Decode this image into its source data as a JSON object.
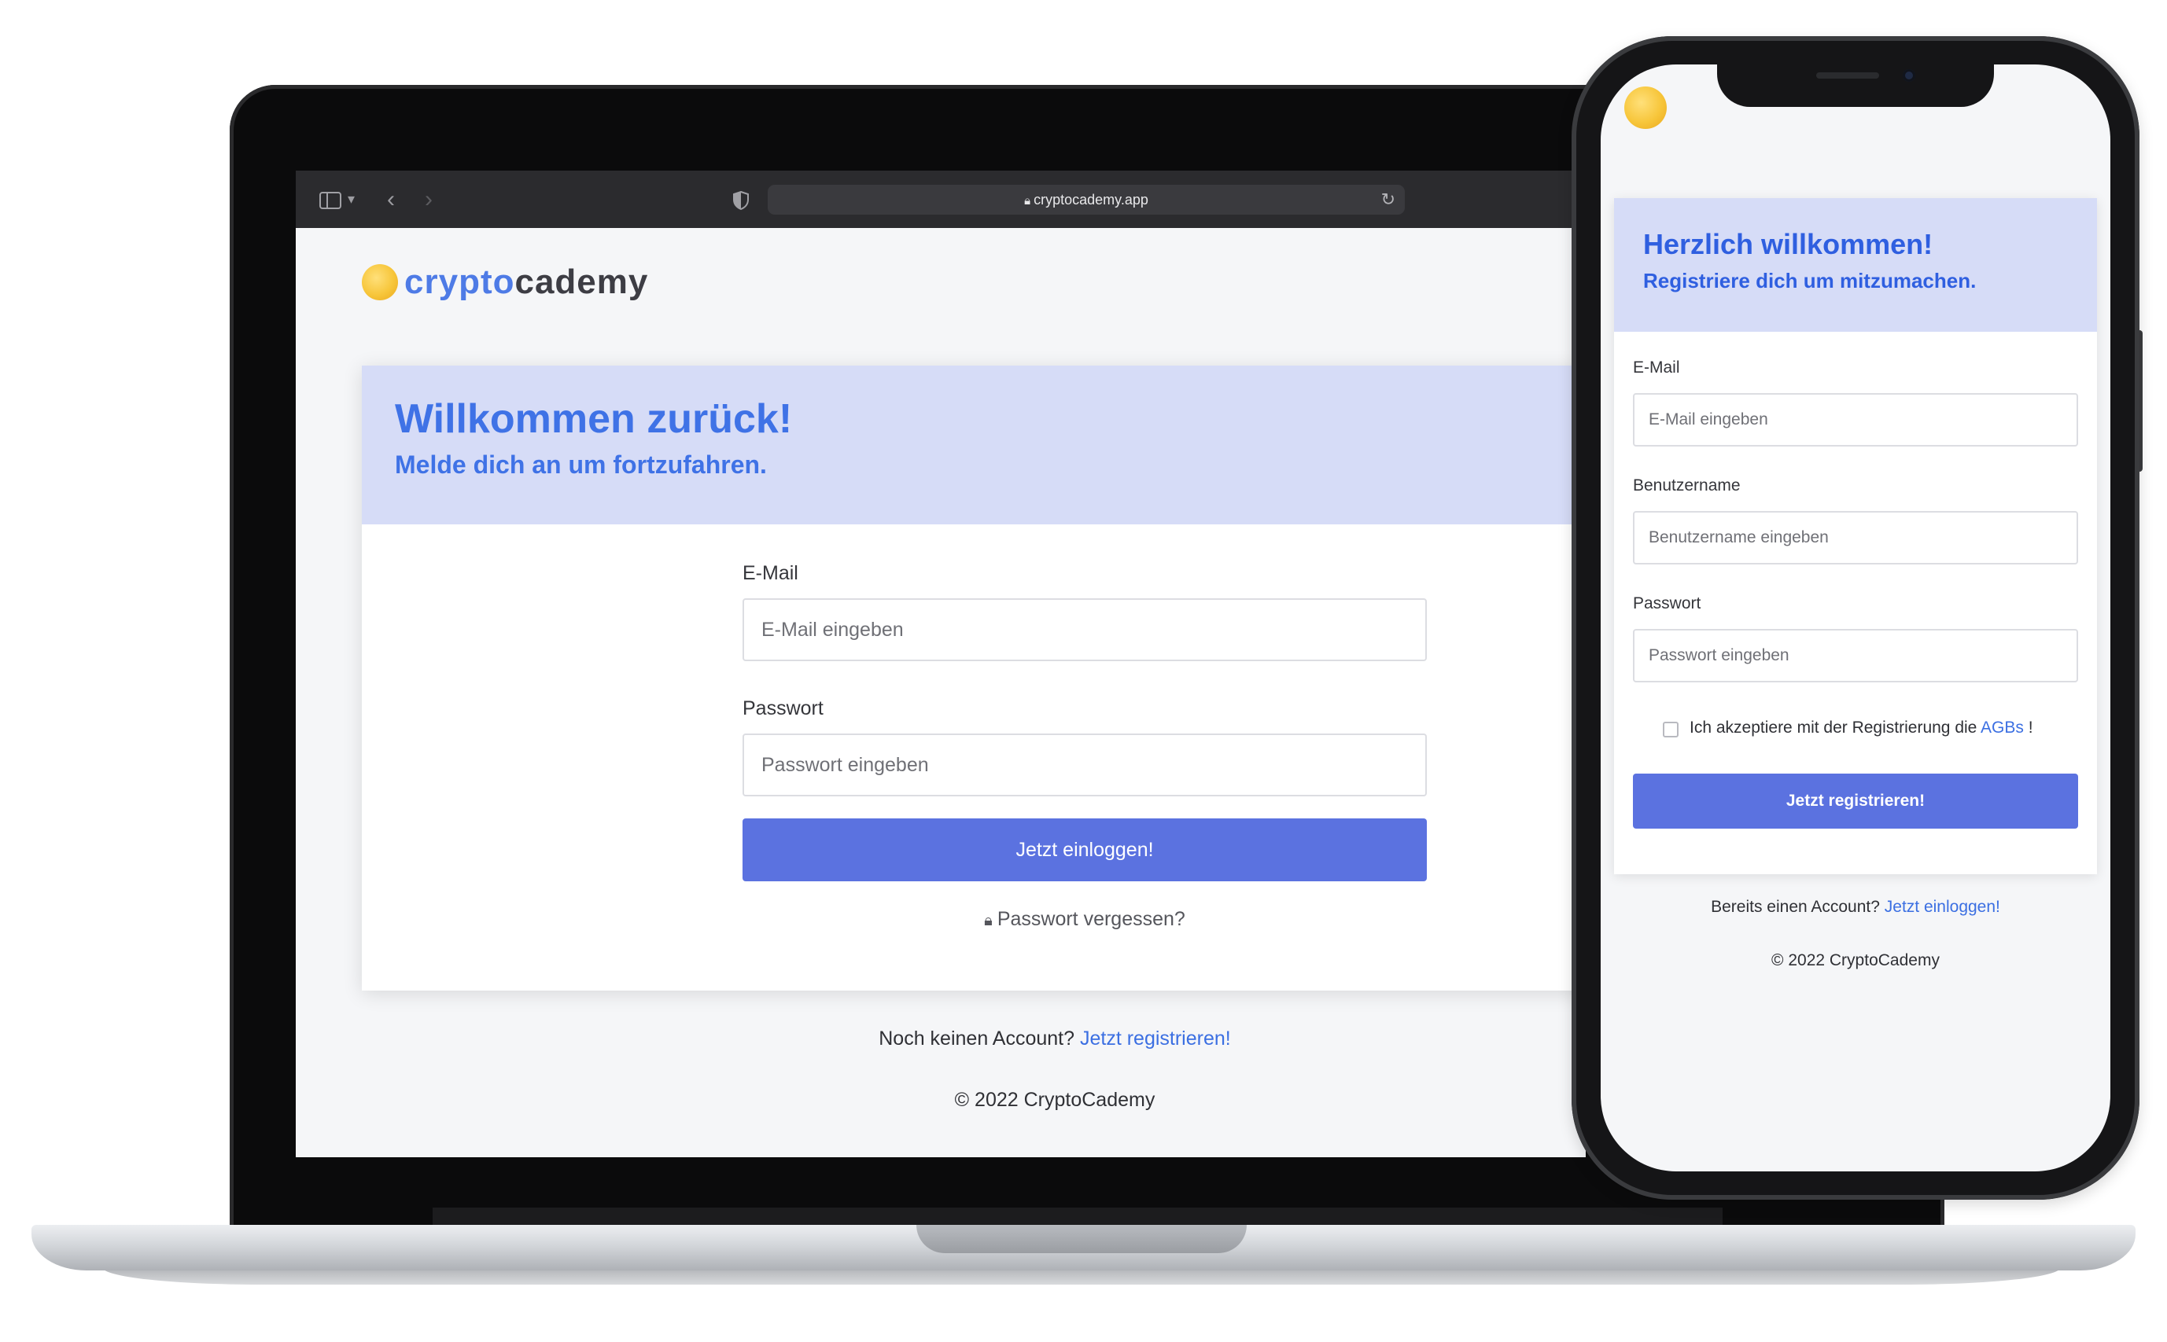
{
  "browser": {
    "url": "cryptocademy.app",
    "icons": {
      "sidebar": "sidebar-toggle-icon",
      "back": "chevron-left-icon",
      "forward": "chevron-right-icon",
      "shield": "shield-icon",
      "lock": "lock-icon",
      "reload": "reload-icon"
    }
  },
  "brand": {
    "logo_part1": "crypto",
    "logo_part2": "cademy",
    "accent_color": "#4e7be6",
    "coin_color": "#f7c63b"
  },
  "login": {
    "title": "Willkommen zurück!",
    "subtitle": "Melde dich an um fortzufahren.",
    "email_label": "E-Mail",
    "email_placeholder": "E-Mail eingeben",
    "password_label": "Passwort",
    "password_placeholder": "Passwort eingeben",
    "submit_label": "Jetzt einloggen!",
    "forgot_label": "Passwort vergessen?",
    "register_prompt": "Noch keinen Account?",
    "register_link": "Jetzt registrieren!",
    "footer": "© 2022 CryptoCademy",
    "button_color": "#5b72e0",
    "banner_color": "#d6dcf7"
  },
  "register": {
    "title": "Herzlich willkommen!",
    "subtitle": "Registriere dich um mitzumachen.",
    "email_label": "E-Mail",
    "email_placeholder": "E-Mail eingeben",
    "username_label": "Benutzername",
    "username_placeholder": "Benutzername eingeben",
    "password_label": "Passwort",
    "password_placeholder": "Passwort eingeben",
    "agb_prefix": "Ich akzeptiere mit der Registrierung die",
    "agb_link": "AGBs",
    "agb_suffix": "!",
    "submit_label": "Jetzt registrieren!",
    "login_prompt": "Bereits einen Account?",
    "login_link": "Jetzt einloggen!",
    "footer": "© 2022 CryptoCademy"
  }
}
